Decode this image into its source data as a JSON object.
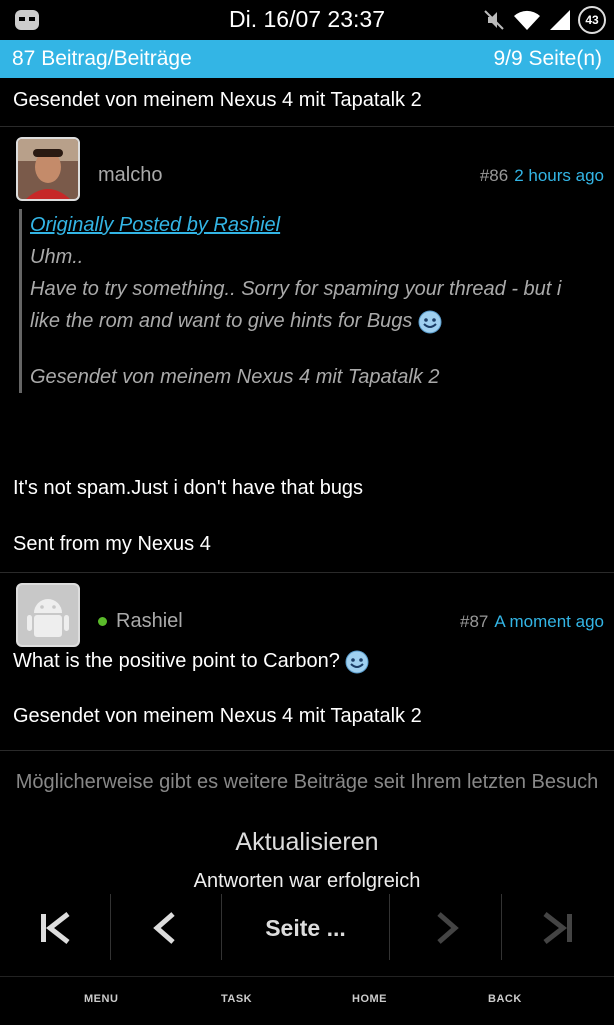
{
  "status": {
    "time": "Di. 16/07 23:37",
    "battery": "43",
    "icons": [
      "mask-icon",
      "mute-icon",
      "wifi-icon",
      "signal-icon",
      "battery-icon"
    ]
  },
  "header": {
    "posts_count": "87 Beitrag/Beiträge",
    "page_info": "9/9 Seite(n)"
  },
  "thread": {
    "prev_signature": "Gesendet von meinem Nexus 4 mit Tapatalk 2",
    "posts": [
      {
        "author": "malcho",
        "number": "#86",
        "time": "2 hours ago",
        "quote": {
          "link": "Originally Posted by Rashiel",
          "line1": "Uhm..",
          "line2": "Have to try something.. Sorry for spaming your thread - but i",
          "line3": "like the rom and want to give hints for Bugs",
          "signature": "Gesendet von meinem Nexus 4 mit Tapatalk 2"
        },
        "body": "It's not spam.Just i don't have that bugs",
        "signature": "Sent from my Nexus 4"
      },
      {
        "author": "Rashiel",
        "number": "#87",
        "time": "A moment ago",
        "body": "What is the positive point to Carbon?",
        "signature": "Gesendet von meinem Nexus 4 mit Tapatalk 2"
      }
    ]
  },
  "notice": "Möglicherweise gibt es weitere Beiträge seit Ihrem letzten Besuch",
  "refresh_label": "Aktualisieren",
  "toast": "Antworten war erfolgreich",
  "pager": {
    "page_label": "Seite ..."
  },
  "navbar": {
    "menu": "MENU",
    "task": "TASK",
    "home": "HOME",
    "back": "BACK"
  },
  "colors": {
    "accent": "#33b5e5",
    "background": "#000000",
    "online": "#5aba2a"
  }
}
